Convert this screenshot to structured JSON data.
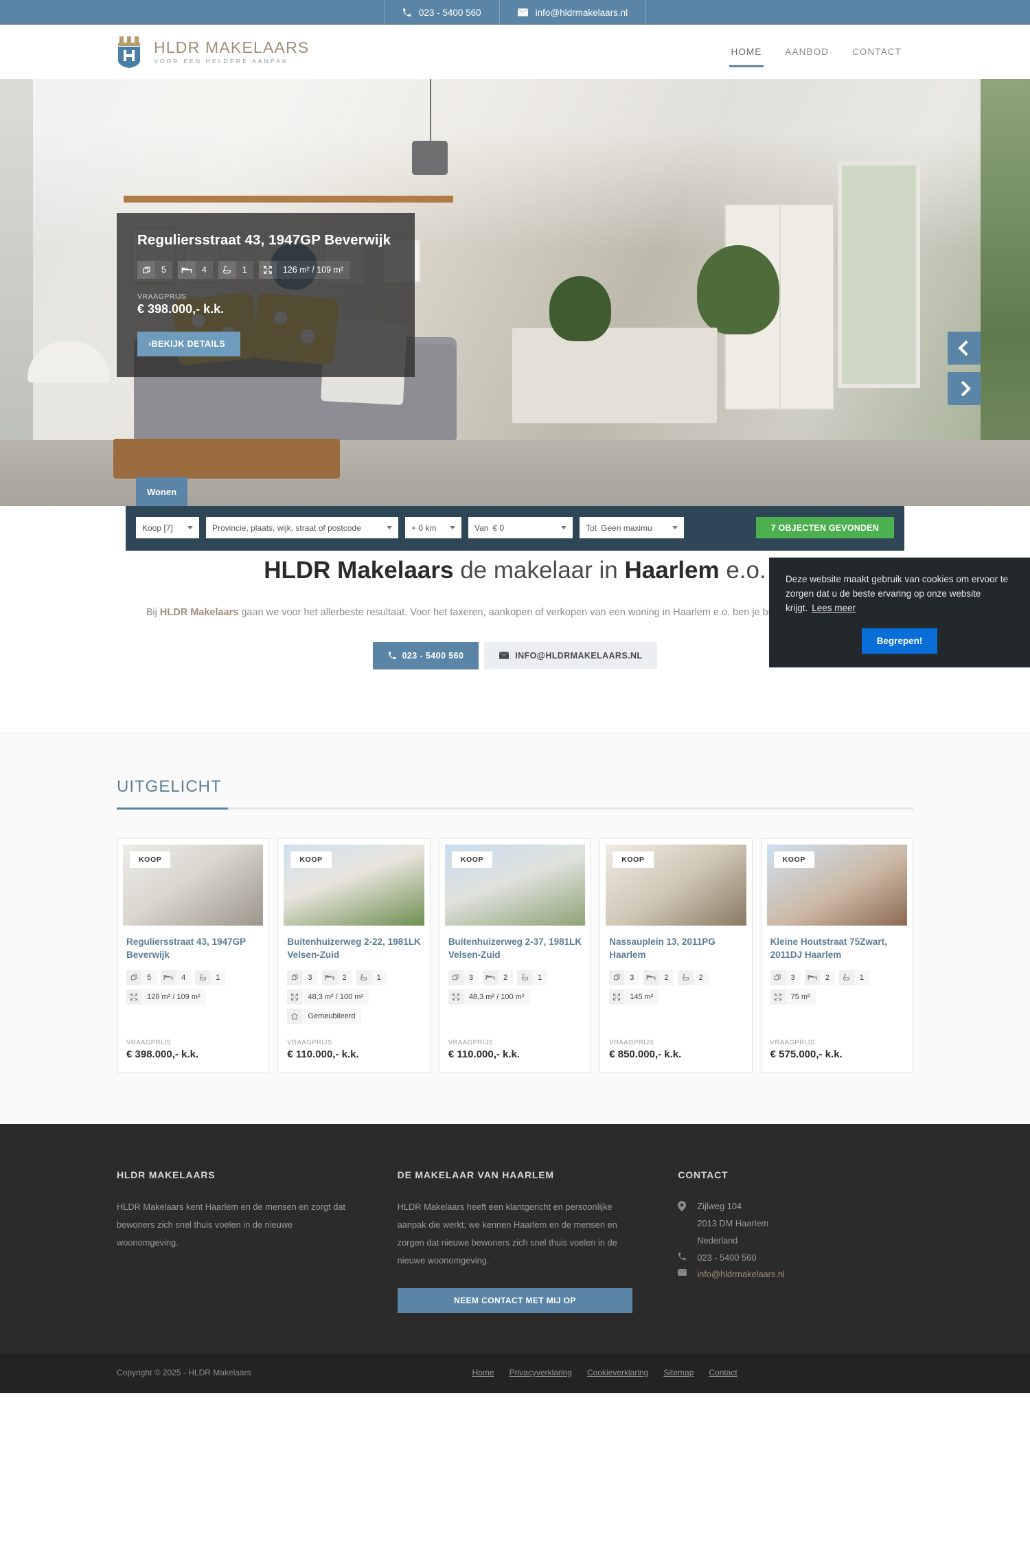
{
  "topbar": {
    "phone": "023 - 5400 560",
    "email": "info@hldrmakelaars.nl",
    "phone_icon": "phone-icon",
    "email_icon": "envelope-icon"
  },
  "header": {
    "logo_main": "HLDR MAKELAARS",
    "logo_sub": "VOOR EEN HELDERE AANPAK",
    "nav": [
      {
        "label": "HOME",
        "active": true
      },
      {
        "label": "AANBOD",
        "active": false
      },
      {
        "label": "CONTACT",
        "active": false
      }
    ]
  },
  "hero": {
    "title": "Reguliersstraat 43, 1947GP Beverwijk",
    "specs": [
      {
        "icon": "rooms-icon",
        "value": "5"
      },
      {
        "icon": "bed-icon",
        "value": "4"
      },
      {
        "icon": "bath-icon",
        "value": "1"
      },
      {
        "icon": "area-icon",
        "value": "126 m² / 109 m²"
      }
    ],
    "price_label": "VRAAGPRIJS",
    "price": "€ 398.000,- k.k.",
    "details_button": "›BEKIJK DETAILS",
    "prev_label": "vorige",
    "next_label": "volgende"
  },
  "search": {
    "tab": "Wonen",
    "type": "Koop [7]",
    "location": "Provincie, plaats, wijk, straat of postcode",
    "radius": "+ 0 km",
    "from_prefix": "Van",
    "from_value": "€ 0",
    "to_prefix": "Tot",
    "to_value": "Geen maximu",
    "submit": "7 OBJECTEN GEVONDEN"
  },
  "cookie": {
    "text": "Deze website maakt gebruik van cookies om ervoor te zorgen dat u de beste ervaring op onze website krijgt.",
    "link": "Lees meer",
    "button": "Begrepen!"
  },
  "intro": {
    "title_bold1": "HLDR Makelaars",
    "title_mid": " de makelaar in ",
    "title_bold2": "Haarlem",
    "title_end": " e.o.",
    "body_pre": "Bij ",
    "body_bold": "HLDR Makelaars",
    "body_post": " gaan we voor het allerbeste resultaat. Voor het taxeren, aankopen of verkopen van een woning in Haarlem e.o. ben je bij ons aan het juiste adres.",
    "phone_button": "023 - 5400 560",
    "mail_button": "INFO@HLDRMAKELAARS.NL"
  },
  "featured": {
    "heading": "UITGELICHT",
    "badge": "KOOP",
    "price_label": "VRAAGPRIJS",
    "cards": [
      {
        "title": "Reguliersstraat 43, 1947GP Beverwijk",
        "specs": [
          {
            "icon": "rooms-icon",
            "value": "5"
          },
          {
            "icon": "bed-icon",
            "value": "4"
          },
          {
            "icon": "bath-icon",
            "value": "1"
          },
          {
            "icon": "area-icon",
            "value": "126 m² / 109 m²"
          }
        ],
        "price": "€ 398.000,- k.k."
      },
      {
        "title": "Buitenhuizerweg 2-22, 1981LK Velsen-Zuid",
        "specs": [
          {
            "icon": "rooms-icon",
            "value": "3"
          },
          {
            "icon": "bed-icon",
            "value": "2"
          },
          {
            "icon": "bath-icon",
            "value": "1"
          },
          {
            "icon": "area-icon",
            "value": "48,3 m² / 100 m²"
          },
          {
            "icon": "home-icon",
            "value": "Gemeubileerd"
          }
        ],
        "price": "€ 110.000,- k.k."
      },
      {
        "title": "Buitenhuizerweg 2-37, 1981LK Velsen-Zuid",
        "specs": [
          {
            "icon": "rooms-icon",
            "value": "3"
          },
          {
            "icon": "bed-icon",
            "value": "2"
          },
          {
            "icon": "bath-icon",
            "value": "1"
          },
          {
            "icon": "area-icon",
            "value": "48,3 m² / 100 m²"
          }
        ],
        "price": "€ 110.000,- k.k."
      },
      {
        "title": "Nassauplein 13, 2011PG Haarlem",
        "specs": [
          {
            "icon": "rooms-icon",
            "value": "3"
          },
          {
            "icon": "bed-icon",
            "value": "2"
          },
          {
            "icon": "bath-icon",
            "value": "2"
          },
          {
            "icon": "area-icon",
            "value": "145 m²"
          }
        ],
        "price": "€ 850.000,- k.k."
      },
      {
        "title": "Kleine Houtstraat 75Zwart, 2011DJ Haarlem",
        "specs": [
          {
            "icon": "rooms-icon",
            "value": "3"
          },
          {
            "icon": "bed-icon",
            "value": "2"
          },
          {
            "icon": "bath-icon",
            "value": "1"
          },
          {
            "icon": "area-icon",
            "value": "75 m²"
          }
        ],
        "price": "€ 575.000,- k.k."
      }
    ]
  },
  "footer": {
    "col1_title": "HLDR MAKELAARS",
    "col1_text": "HLDR Makelaars kent Haarlem en de mensen en zorgt dat bewoners zich snel thuis voelen in de nieuwe woonomgeving.",
    "col2_title": "DE MAKELAAR VAN HAARLEM",
    "col2_text": "HLDR Makelaars heeft een klantgericht en persoonlijke aanpak die werkt; we kennen Haarlem en de mensen en zorgen dat nieuwe bewoners zich snel thuis voelen in de nieuwe woonomgeving.",
    "col2_button": "NEEM CONTACT MET MIJ OP",
    "col3_title": "CONTACT",
    "address_line1": "Zijlweg 104",
    "address_line2": "2013 DM Haarlem",
    "address_line3": "Nederland",
    "phone": "023 - 5400 560",
    "email": "info@hldrmakelaars.nl",
    "copyright": "Copyright © 2025 - HLDR Makelaars",
    "links": [
      "Home",
      "Privacyverklaring",
      "Cookieverklaring",
      "Sitemap",
      "Contact"
    ]
  }
}
